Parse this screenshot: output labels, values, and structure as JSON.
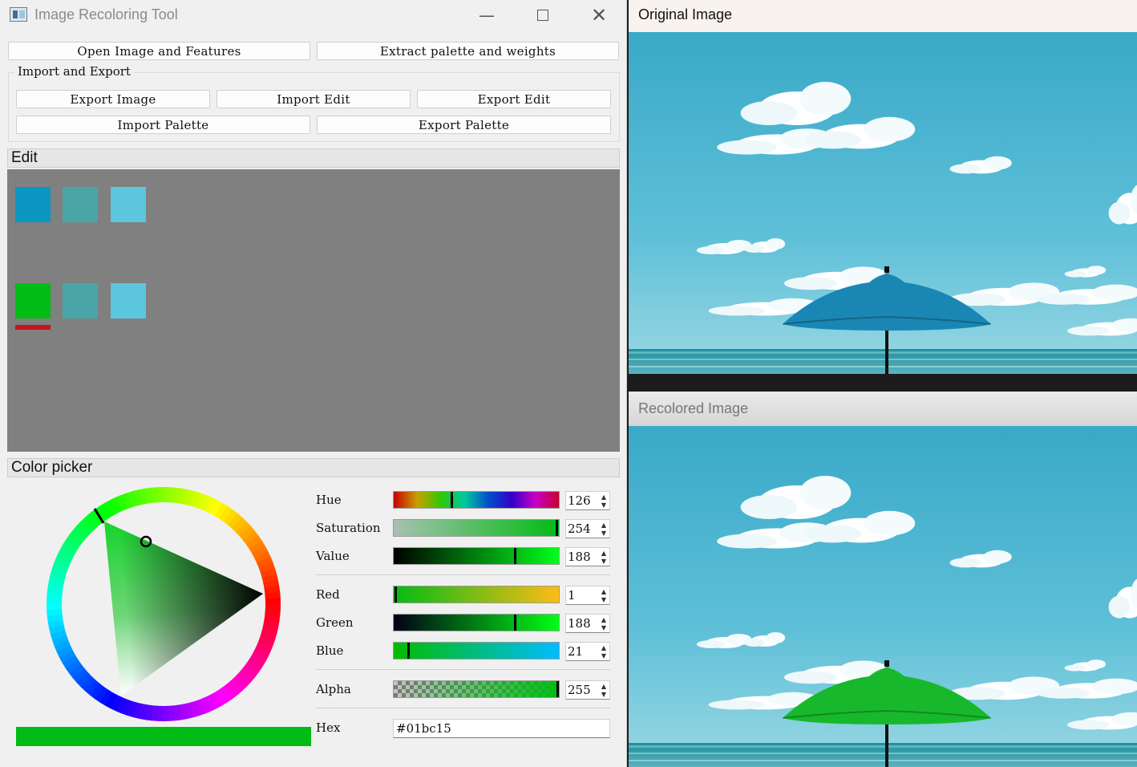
{
  "window": {
    "title": "Image Recoloring Tool",
    "minimize": "—",
    "close": "✕"
  },
  "toolbar": {
    "open_label": "Open Image and Features",
    "extract_label": "Extract palette and weights"
  },
  "import_export": {
    "group_title": "Import and Export",
    "export_image": "Export Image",
    "import_edit": "Import Edit",
    "export_edit": "Export Edit",
    "import_palette": "Import Palette",
    "export_palette": "Export Palette"
  },
  "edit": {
    "section_title": "Edit",
    "original_palette": [
      "#0b97c1",
      "#4aa5a7",
      "#5bc6dc"
    ],
    "edited_palette": [
      "#01bc15",
      "#4aa5a7",
      "#5bc6dc"
    ],
    "selected_marker_color": "#c8141e",
    "selected_index": 0
  },
  "color_picker": {
    "section_title": "Color picker",
    "current_color": "#01bc15",
    "hue": {
      "label": "Hue",
      "value": "126",
      "max": 359
    },
    "saturation": {
      "label": "Saturation",
      "value": "254",
      "max": 255
    },
    "value": {
      "label": "Value",
      "value": "188",
      "max": 255
    },
    "red": {
      "label": "Red",
      "value": "1",
      "max": 255
    },
    "green": {
      "label": "Green",
      "value": "188",
      "max": 255
    },
    "blue": {
      "label": "Blue",
      "value": "21",
      "max": 255
    },
    "alpha": {
      "label": "Alpha",
      "value": "255",
      "max": 255
    },
    "hex": {
      "label": "Hex",
      "value": "#01bc15"
    }
  },
  "original_window": {
    "title": "Original Image",
    "umbrella_color": "#1a86b4"
  },
  "recolored_window": {
    "title": "Recolored Image",
    "umbrella_color": "#18b82c"
  }
}
